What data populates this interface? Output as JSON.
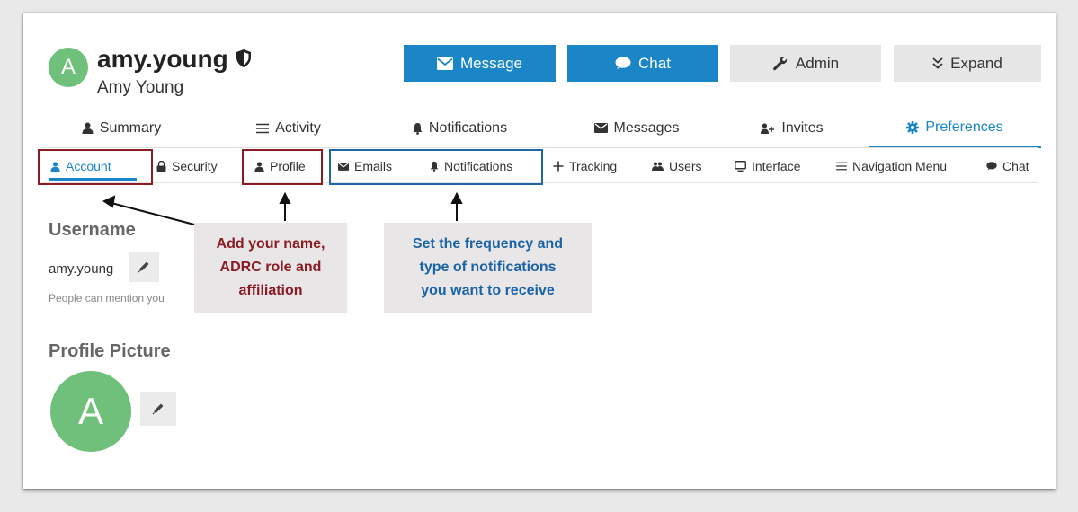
{
  "header": {
    "avatar_letter": "A",
    "username": "amy.young",
    "full_name": "Amy Young",
    "buttons": {
      "message": "Message",
      "chat": "Chat",
      "admin": "Admin",
      "expand": "Expand"
    }
  },
  "main_tabs": [
    {
      "label": "Summary",
      "icon": "person-icon"
    },
    {
      "label": "Activity",
      "icon": "list-icon"
    },
    {
      "label": "Notifications",
      "icon": "bell-icon"
    },
    {
      "label": "Messages",
      "icon": "envelope-icon"
    },
    {
      "label": "Invites",
      "icon": "person-plus-icon"
    },
    {
      "label": "Preferences",
      "icon": "gear-icon",
      "active": true
    }
  ],
  "sub_tabs": [
    {
      "label": "Account",
      "icon": "person-icon",
      "active": true
    },
    {
      "label": "Security",
      "icon": "lock-icon"
    },
    {
      "label": "Profile",
      "icon": "person-icon"
    },
    {
      "label": "Emails",
      "icon": "envelope-icon"
    },
    {
      "label": "Notifications",
      "icon": "bell-icon"
    },
    {
      "label": "Tracking",
      "icon": "plus-icon"
    },
    {
      "label": "Users",
      "icon": "users-icon"
    },
    {
      "label": "Interface",
      "icon": "monitor-icon"
    },
    {
      "label": "Navigation Menu",
      "icon": "list-icon"
    },
    {
      "label": "Chat",
      "icon": "chat-icon"
    }
  ],
  "content": {
    "username_title": "Username",
    "username_value": "amy.young",
    "username_help": "People can mention you",
    "picture_title": "Profile Picture",
    "picture_letter": "A"
  },
  "callouts": {
    "profile": [
      "Add your name,",
      "ADRC role and",
      "affiliation"
    ],
    "notifications": [
      "Set the frequency and",
      "type of notifications",
      "you want to receive"
    ]
  },
  "colors": {
    "accent_blue": "#1a86c8",
    "annotation_red": "#8b1c24",
    "annotation_blue": "#1a63a6",
    "avatar_green": "#6fc07a"
  }
}
